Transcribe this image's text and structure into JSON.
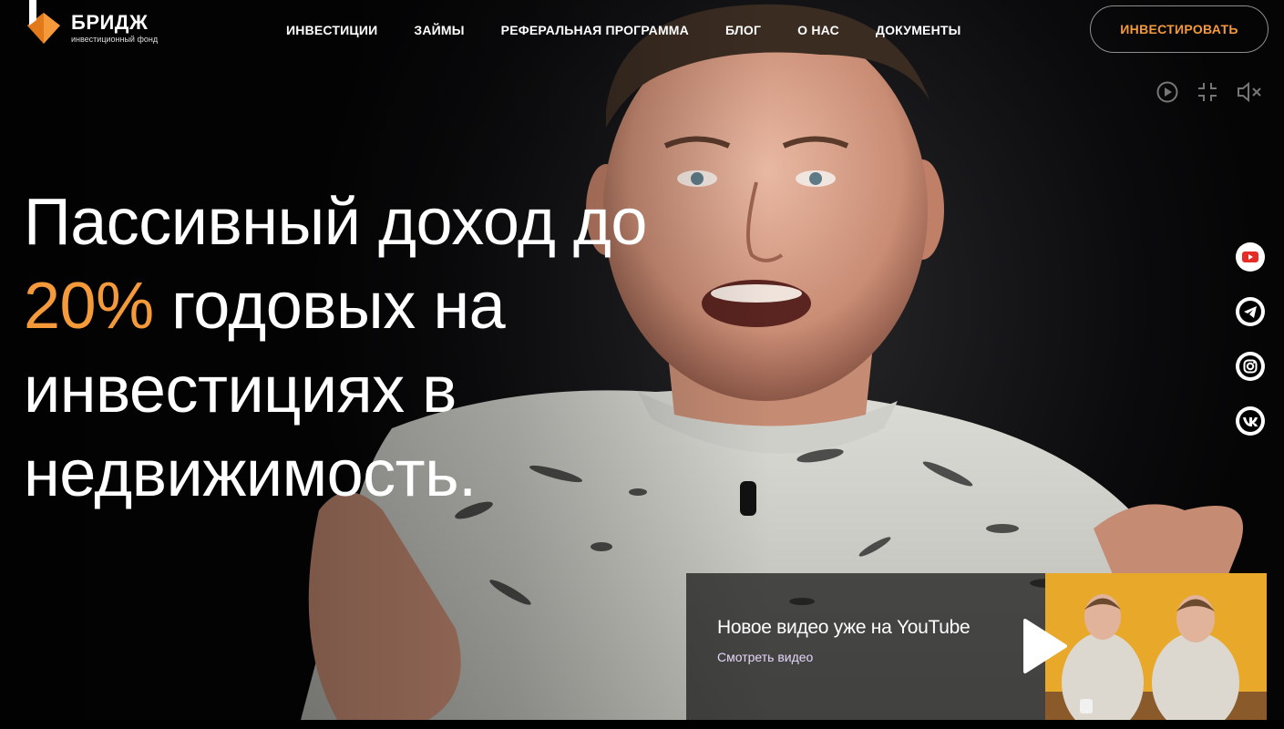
{
  "header": {
    "logo": {
      "name": "БРИДЖ",
      "subtitle": "инвестиционный фонд"
    },
    "nav": [
      "ИНВЕСТИЦИИ",
      "ЗАЙМЫ",
      "РЕФЕРАЛЬНАЯ ПРОГРАММА",
      "БЛОГ",
      "О НАС",
      "ДОКУМЕНТЫ"
    ],
    "cta_label": "ИНВЕСТИРОВАТЬ"
  },
  "video_controls": [
    "play-icon",
    "exit-fullscreen-icon",
    "mute-icon"
  ],
  "hero": {
    "line1": "Пассивный доход до",
    "accent": "20%",
    "line2_rest": " годовых на",
    "line3": "инвестициях в",
    "line4": "недвижимость."
  },
  "social": [
    "youtube-icon",
    "telegram-icon",
    "instagram-icon",
    "vk-icon"
  ],
  "promo": {
    "title": "Новое видео уже на YouTube",
    "link": "Смотреть видео"
  },
  "colors": {
    "accent": "#f49a3b",
    "background": "#0b0b0d",
    "promo_link": "#e5d6f7"
  }
}
